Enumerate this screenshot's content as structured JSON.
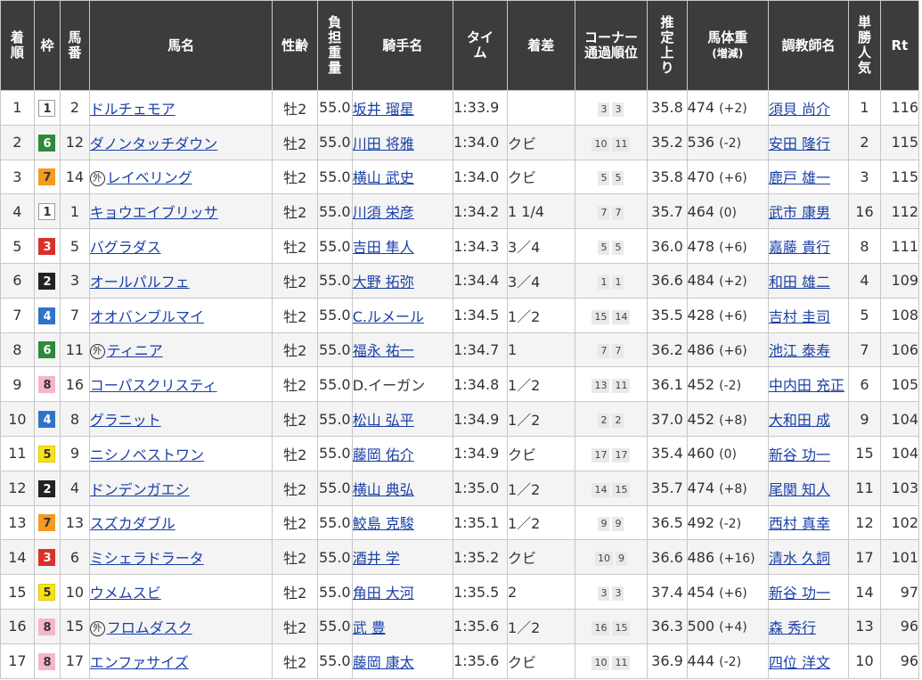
{
  "headers": {
    "rank": [
      "着",
      "順"
    ],
    "frame": "枠",
    "horse_number": [
      "馬",
      "番"
    ],
    "horse_name": "馬名",
    "sex_age": "性齢",
    "weight_carried": [
      "負",
      "担",
      "重",
      "量"
    ],
    "jockey": "騎手名",
    "time": [
      "タイ",
      "ム"
    ],
    "margin": "着差",
    "corner": [
      "コーナー",
      "通過順位"
    ],
    "last_3f": [
      "推",
      "定",
      "上",
      "り"
    ],
    "body_weight": [
      "馬体重",
      "(増減)"
    ],
    "trainer": "調教師名",
    "popularity": [
      "単",
      "勝",
      "人",
      "気"
    ],
    "rating": "Rt"
  },
  "frame_colors": {
    "1": {
      "bg": "#ffffff",
      "fg": "#333333",
      "border": "#999999"
    },
    "2": {
      "bg": "#222222",
      "fg": "#ffffff",
      "border": "#222222"
    },
    "3": {
      "bg": "#d9302c",
      "fg": "#ffffff",
      "border": "#d9302c"
    },
    "4": {
      "bg": "#2f74c9",
      "fg": "#ffffff",
      "border": "#2f74c9"
    },
    "5": {
      "bg": "#f6e21a",
      "fg": "#333333",
      "border": "#e0c800"
    },
    "6": {
      "bg": "#2e8a3b",
      "fg": "#ffffff",
      "border": "#2e8a3b"
    },
    "7": {
      "bg": "#f59b1f",
      "fg": "#333333",
      "border": "#f59b1f"
    },
    "8": {
      "bg": "#f7b6c8",
      "fg": "#333333",
      "border": "#f7b6c8"
    }
  },
  "foreign_mark": "外",
  "rows": [
    {
      "rank": "1",
      "frame": "1",
      "num": "2",
      "name": "ドルチェモア",
      "foreign": false,
      "sex_age": "牡2",
      "wt": "55.0",
      "jockey": "坂井 瑠星",
      "jockey_link": true,
      "time": "1:33.9",
      "margin": "",
      "corner": [
        "3",
        "3"
      ],
      "last3f": "35.8",
      "bw": "474",
      "bwd": "(+2)",
      "trainer": "須貝 尚介",
      "pop": "1",
      "rt": "116"
    },
    {
      "rank": "2",
      "frame": "6",
      "num": "12",
      "name": "ダノンタッチダウン",
      "foreign": false,
      "sex_age": "牡2",
      "wt": "55.0",
      "jockey": "川田 将雅",
      "jockey_link": true,
      "time": "1:34.0",
      "margin": "クビ",
      "corner": [
        "10",
        "11"
      ],
      "last3f": "35.2",
      "bw": "536",
      "bwd": "(-2)",
      "trainer": "安田 隆行",
      "pop": "2",
      "rt": "115"
    },
    {
      "rank": "3",
      "frame": "7",
      "num": "14",
      "name": "レイベリング",
      "foreign": true,
      "sex_age": "牡2",
      "wt": "55.0",
      "jockey": "横山 武史",
      "jockey_link": true,
      "time": "1:34.0",
      "margin": "クビ",
      "corner": [
        "5",
        "5"
      ],
      "last3f": "35.8",
      "bw": "470",
      "bwd": "(+6)",
      "trainer": "鹿戸 雄一",
      "pop": "3",
      "rt": "115"
    },
    {
      "rank": "4",
      "frame": "1",
      "num": "1",
      "name": "キョウエイブリッサ",
      "foreign": false,
      "sex_age": "牡2",
      "wt": "55.0",
      "jockey": "川須 栄彦",
      "jockey_link": true,
      "time": "1:34.2",
      "margin": "1 1/4",
      "corner": [
        "7",
        "7"
      ],
      "last3f": "35.7",
      "bw": "464",
      "bwd": "(0)",
      "trainer": "武市 康男",
      "pop": "16",
      "rt": "112"
    },
    {
      "rank": "5",
      "frame": "3",
      "num": "5",
      "name": "バグラダス",
      "foreign": false,
      "sex_age": "牡2",
      "wt": "55.0",
      "jockey": "吉田 隼人",
      "jockey_link": true,
      "time": "1:34.3",
      "margin": "3／4",
      "corner": [
        "5",
        "5"
      ],
      "last3f": "36.0",
      "bw": "478",
      "bwd": "(+6)",
      "trainer": "嘉藤 貴行",
      "pop": "8",
      "rt": "111"
    },
    {
      "rank": "6",
      "frame": "2",
      "num": "3",
      "name": "オールパルフェ",
      "foreign": false,
      "sex_age": "牡2",
      "wt": "55.0",
      "jockey": "大野 拓弥",
      "jockey_link": true,
      "time": "1:34.4",
      "margin": "3／4",
      "corner": [
        "1",
        "1"
      ],
      "last3f": "36.6",
      "bw": "484",
      "bwd": "(+2)",
      "trainer": "和田 雄二",
      "pop": "4",
      "rt": "109"
    },
    {
      "rank": "7",
      "frame": "4",
      "num": "7",
      "name": "オオバンブルマイ",
      "foreign": false,
      "sex_age": "牡2",
      "wt": "55.0",
      "jockey": "C.ルメール",
      "jockey_link": true,
      "time": "1:34.5",
      "margin": "1／2",
      "corner": [
        "15",
        "14"
      ],
      "last3f": "35.5",
      "bw": "428",
      "bwd": "(+6)",
      "trainer": "吉村 圭司",
      "pop": "5",
      "rt": "108"
    },
    {
      "rank": "8",
      "frame": "6",
      "num": "11",
      "name": "ティニア",
      "foreign": true,
      "sex_age": "牡2",
      "wt": "55.0",
      "jockey": "福永 祐一",
      "jockey_link": true,
      "time": "1:34.7",
      "margin": "1",
      "corner": [
        "7",
        "7"
      ],
      "last3f": "36.2",
      "bw": "486",
      "bwd": "(+6)",
      "trainer": "池江 泰寿",
      "pop": "7",
      "rt": "106"
    },
    {
      "rank": "9",
      "frame": "8",
      "num": "16",
      "name": "コーパスクリスティ",
      "foreign": false,
      "sex_age": "牡2",
      "wt": "55.0",
      "jockey": "D.イーガン",
      "jockey_link": false,
      "time": "1:34.8",
      "margin": "1／2",
      "corner": [
        "13",
        "11"
      ],
      "last3f": "36.1",
      "bw": "452",
      "bwd": "(-2)",
      "trainer": "中内田 充正",
      "pop": "6",
      "rt": "105"
    },
    {
      "rank": "10",
      "frame": "4",
      "num": "8",
      "name": "グラニット",
      "foreign": false,
      "sex_age": "牡2",
      "wt": "55.0",
      "jockey": "松山 弘平",
      "jockey_link": true,
      "time": "1:34.9",
      "margin": "1／2",
      "corner": [
        "2",
        "2"
      ],
      "last3f": "37.0",
      "bw": "452",
      "bwd": "(+8)",
      "trainer": "大和田 成",
      "pop": "9",
      "rt": "104"
    },
    {
      "rank": "11",
      "frame": "5",
      "num": "9",
      "name": "ニシノベストワン",
      "foreign": false,
      "sex_age": "牡2",
      "wt": "55.0",
      "jockey": "藤岡 佑介",
      "jockey_link": true,
      "time": "1:34.9",
      "margin": "クビ",
      "corner": [
        "17",
        "17"
      ],
      "last3f": "35.4",
      "bw": "460",
      "bwd": "(0)",
      "trainer": "新谷 功一",
      "pop": "15",
      "rt": "104"
    },
    {
      "rank": "12",
      "frame": "2",
      "num": "4",
      "name": "ドンデンガエシ",
      "foreign": false,
      "sex_age": "牡2",
      "wt": "55.0",
      "jockey": "横山 典弘",
      "jockey_link": true,
      "time": "1:35.0",
      "margin": "1／2",
      "corner": [
        "14",
        "15"
      ],
      "last3f": "35.7",
      "bw": "474",
      "bwd": "(+8)",
      "trainer": "尾関 知人",
      "pop": "11",
      "rt": "103"
    },
    {
      "rank": "13",
      "frame": "7",
      "num": "13",
      "name": "スズカダブル",
      "foreign": false,
      "sex_age": "牡2",
      "wt": "55.0",
      "jockey": "鮫島 克駿",
      "jockey_link": true,
      "time": "1:35.1",
      "margin": "1／2",
      "corner": [
        "9",
        "9"
      ],
      "last3f": "36.5",
      "bw": "492",
      "bwd": "(-2)",
      "trainer": "西村 真幸",
      "pop": "12",
      "rt": "102"
    },
    {
      "rank": "14",
      "frame": "3",
      "num": "6",
      "name": "ミシェラドラータ",
      "foreign": false,
      "sex_age": "牡2",
      "wt": "55.0",
      "jockey": "酒井 学",
      "jockey_link": true,
      "time": "1:35.2",
      "margin": "クビ",
      "corner": [
        "10",
        "9"
      ],
      "last3f": "36.6",
      "bw": "486",
      "bwd": "(+16)",
      "trainer": "清水 久詞",
      "pop": "17",
      "rt": "101"
    },
    {
      "rank": "15",
      "frame": "5",
      "num": "10",
      "name": "ウメムスビ",
      "foreign": false,
      "sex_age": "牡2",
      "wt": "55.0",
      "jockey": "角田 大河",
      "jockey_link": true,
      "time": "1:35.5",
      "margin": "2",
      "corner": [
        "3",
        "3"
      ],
      "last3f": "37.4",
      "bw": "454",
      "bwd": "(+6)",
      "trainer": "新谷 功一",
      "pop": "14",
      "rt": "97"
    },
    {
      "rank": "16",
      "frame": "8",
      "num": "15",
      "name": "フロムダスク",
      "foreign": true,
      "sex_age": "牡2",
      "wt": "55.0",
      "jockey": "武 豊",
      "jockey_link": true,
      "time": "1:35.6",
      "margin": "1／2",
      "corner": [
        "16",
        "15"
      ],
      "last3f": "36.3",
      "bw": "500",
      "bwd": "(+4)",
      "trainer": "森 秀行",
      "pop": "13",
      "rt": "96"
    },
    {
      "rank": "17",
      "frame": "8",
      "num": "17",
      "name": "エンファサイズ",
      "foreign": false,
      "sex_age": "牡2",
      "wt": "55.0",
      "jockey": "藤岡 康太",
      "jockey_link": true,
      "time": "1:35.6",
      "margin": "クビ",
      "corner": [
        "10",
        "11"
      ],
      "last3f": "36.9",
      "bw": "444",
      "bwd": "(-2)",
      "trainer": "四位 洋文",
      "pop": "10",
      "rt": "96"
    }
  ]
}
